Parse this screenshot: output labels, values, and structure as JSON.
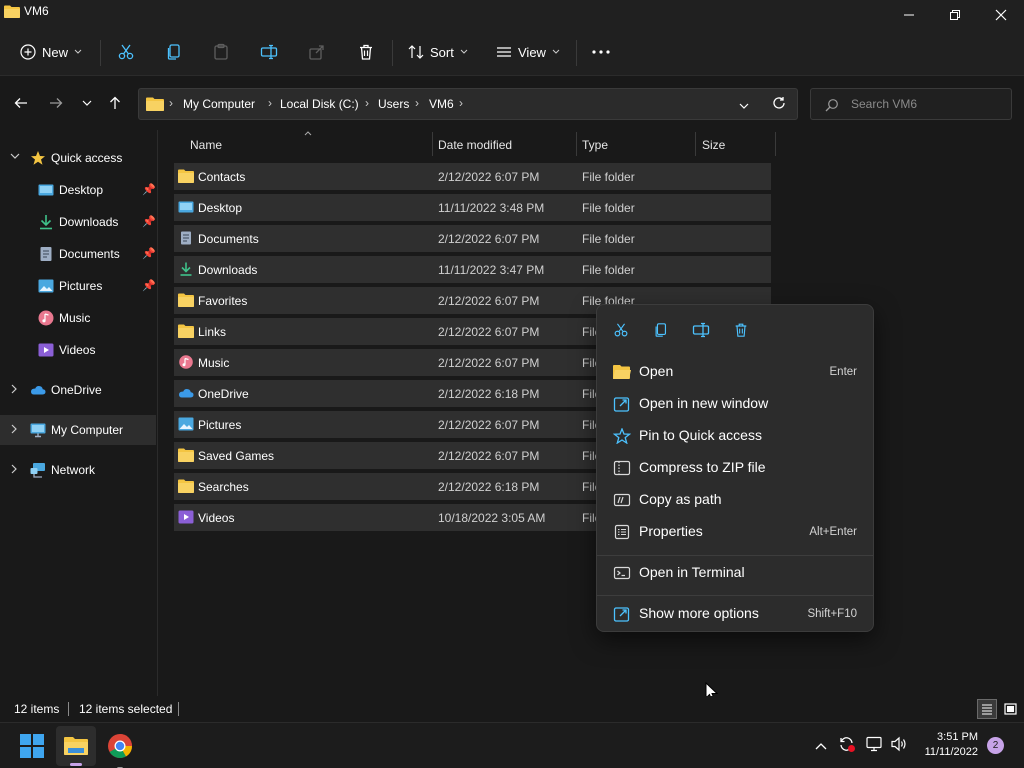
{
  "window": {
    "title": "VM6"
  },
  "toolbar": {
    "new_label": "New",
    "sort_label": "Sort",
    "view_label": "View"
  },
  "breadcrumb": [
    "My Computer",
    "Local Disk (C:)",
    "Users",
    "VM6"
  ],
  "search": {
    "placeholder": "Search VM6"
  },
  "sidebar": {
    "quick_access": "Quick access",
    "items": [
      {
        "label": "Desktop",
        "icon": "desktop-icon",
        "pinned": true
      },
      {
        "label": "Downloads",
        "icon": "download-icon",
        "pinned": true
      },
      {
        "label": "Documents",
        "icon": "document-icon",
        "pinned": true
      },
      {
        "label": "Pictures",
        "icon": "picture-icon",
        "pinned": true
      },
      {
        "label": "Music",
        "icon": "music-icon",
        "pinned": false
      },
      {
        "label": "Videos",
        "icon": "video-icon",
        "pinned": false
      }
    ],
    "onedrive": "OneDrive",
    "my_computer": "My Computer",
    "network": "Network"
  },
  "columns": {
    "name": "Name",
    "date": "Date modified",
    "type": "Type",
    "size": "Size"
  },
  "files": [
    {
      "name": "Contacts",
      "date": "2/12/2022 6:07 PM",
      "type": "File folder",
      "icon": "folder-icon"
    },
    {
      "name": "Desktop",
      "date": "11/11/2022 3:48 PM",
      "type": "File folder",
      "icon": "desktop-icon"
    },
    {
      "name": "Documents",
      "date": "2/12/2022 6:07 PM",
      "type": "File folder",
      "icon": "document-icon"
    },
    {
      "name": "Downloads",
      "date": "11/11/2022 3:47 PM",
      "type": "File folder",
      "icon": "download-icon"
    },
    {
      "name": "Favorites",
      "date": "2/12/2022 6:07 PM",
      "type": "File folder",
      "icon": "folder-icon"
    },
    {
      "name": "Links",
      "date": "2/12/2022 6:07 PM",
      "type": "File",
      "icon": "folder-icon"
    },
    {
      "name": "Music",
      "date": "2/12/2022 6:07 PM",
      "type": "File",
      "icon": "music-icon"
    },
    {
      "name": "OneDrive",
      "date": "2/12/2022 6:18 PM",
      "type": "File",
      "icon": "cloud-icon"
    },
    {
      "name": "Pictures",
      "date": "2/12/2022 6:07 PM",
      "type": "File",
      "icon": "picture-icon"
    },
    {
      "name": "Saved Games",
      "date": "2/12/2022 6:07 PM",
      "type": "File",
      "icon": "folder-icon"
    },
    {
      "name": "Searches",
      "date": "2/12/2022 6:18 PM",
      "type": "File",
      "icon": "folder-icon"
    },
    {
      "name": "Videos",
      "date": "10/18/2022 3:05 AM",
      "type": "File",
      "icon": "video-icon"
    }
  ],
  "context_menu": {
    "items": [
      {
        "label": "Open",
        "shortcut": "Enter",
        "icon": "folder-open-icon"
      },
      {
        "label": "Open in new window",
        "shortcut": "",
        "icon": "new-window-icon"
      },
      {
        "label": "Pin to Quick access",
        "shortcut": "",
        "icon": "star-icon"
      },
      {
        "label": "Compress to ZIP file",
        "shortcut": "",
        "icon": "zip-icon"
      },
      {
        "label": "Copy as path",
        "shortcut": "",
        "icon": "copy-path-icon"
      },
      {
        "label": "Properties",
        "shortcut": "Alt+Enter",
        "icon": "properties-icon"
      },
      {
        "label": "Open in Terminal",
        "shortcut": "",
        "icon": "terminal-icon"
      },
      {
        "label": "Show more options",
        "shortcut": "Shift+F10",
        "icon": "more-options-icon"
      }
    ]
  },
  "status": {
    "count": "12 items",
    "selected": "12 items selected"
  },
  "tray": {
    "time": "3:51 PM",
    "date": "11/11/2022",
    "notifications": "2"
  },
  "colors": {
    "folder": "#f4c542",
    "accent": "#4cc2ff",
    "row_selected": "#2f2f2f"
  }
}
